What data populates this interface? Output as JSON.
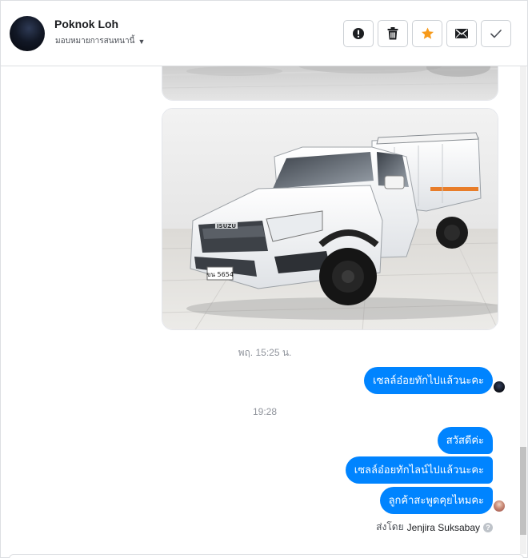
{
  "header": {
    "name": "Poknok Loh",
    "assign_label": "มอบหมายการสนทนานี้",
    "actions": [
      {
        "name": "report-button",
        "icon": "exclamation-icon"
      },
      {
        "name": "delete-button",
        "icon": "trash-icon"
      },
      {
        "name": "star-button",
        "icon": "star-icon",
        "color": "#f79a1a"
      },
      {
        "name": "email-button",
        "icon": "envelope-icon"
      },
      {
        "name": "mark-done-button",
        "icon": "checkmark-icon"
      }
    ]
  },
  "thread": {
    "timestamp_1": "พฤ. 15:25 น.",
    "message_1": "เซลล์อ๋อยทักไปแล้วนะคะ",
    "timestamp_2": "19:28",
    "message_2": "สวัสดีค่ะ",
    "message_3": "เซลล์อ๋อยทักไลน์ไปแล้วนะคะ",
    "message_4": "ลูกค้าสะพูดคุยไหมคะ",
    "sent_by_prefix": "ส่งโดย",
    "sent_by_name": "Jenjira Suksabay",
    "help_glyph": "?",
    "truck_plate": "ขน 5654",
    "truck_brand": "ISUZU"
  },
  "colors": {
    "bubble": "#0084ff",
    "star": "#f79a1a"
  }
}
